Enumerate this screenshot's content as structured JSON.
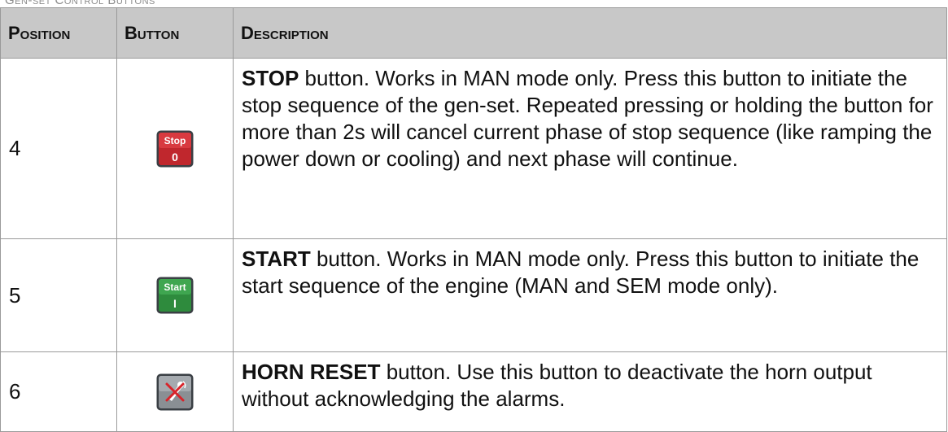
{
  "caption": "Gen-set Control Buttons",
  "header": {
    "position": "Position",
    "button": "Button",
    "description": "Description"
  },
  "rows": [
    {
      "position": "4",
      "icon": "stop-button-icon",
      "icon_label": "Stop",
      "icon_symbol": "0",
      "icon_color": "#c0272d",
      "name": "STOP",
      "text": " button. Works in MAN mode only. Press this button to initiate the stop sequence of the gen-set. Repeated pressing or holding the button for more than 2s will cancel current phase of stop sequence (like ramping the power down or cooling) and next phase will continue."
    },
    {
      "position": "5",
      "icon": "start-button-icon",
      "icon_label": "Start",
      "icon_symbol": "I",
      "icon_color": "#2e8b3d",
      "name": "START",
      "text": " button. Works in MAN mode only. Press this button to initiate the start sequence of the engine (MAN and SEM mode only)."
    },
    {
      "position": "6",
      "icon": "horn-reset-button-icon",
      "icon_color": "#8a8f94",
      "name": "HORN RESET",
      "text": " button. Use this button to deactivate the horn output without acknowledging the alarms."
    }
  ]
}
